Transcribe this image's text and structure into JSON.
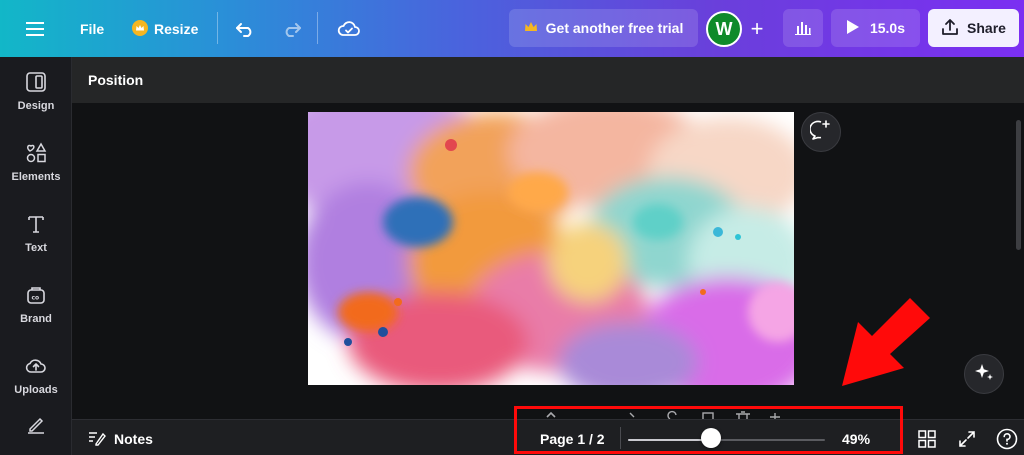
{
  "topbar": {
    "file_label": "File",
    "resize_label": "Resize",
    "trial_label": "Get another free trial",
    "avatar_initial": "W",
    "add_symbol": "+",
    "play_label": "15.0s",
    "share_label": "Share"
  },
  "sidebar": {
    "items": [
      {
        "label": "Design",
        "icon": "design-icon"
      },
      {
        "label": "Elements",
        "icon": "elements-icon"
      },
      {
        "label": "Text",
        "icon": "text-icon"
      },
      {
        "label": "Brand",
        "icon": "brand-icon"
      },
      {
        "label": "Uploads",
        "icon": "uploads-icon"
      },
      {
        "label": "",
        "icon": "draw-icon"
      }
    ]
  },
  "subheader": {
    "title": "Position"
  },
  "bottombar": {
    "notes_label": "Notes",
    "page_label": "Page 1 / 2",
    "zoom_value": "49%",
    "zoom_fraction": 0.42
  },
  "colors": {
    "accent_red": "#ff0a0a",
    "gradient_start": "#12b7c8",
    "gradient_end": "#7b2ff2",
    "avatar_bg": "#0f8a2a"
  }
}
